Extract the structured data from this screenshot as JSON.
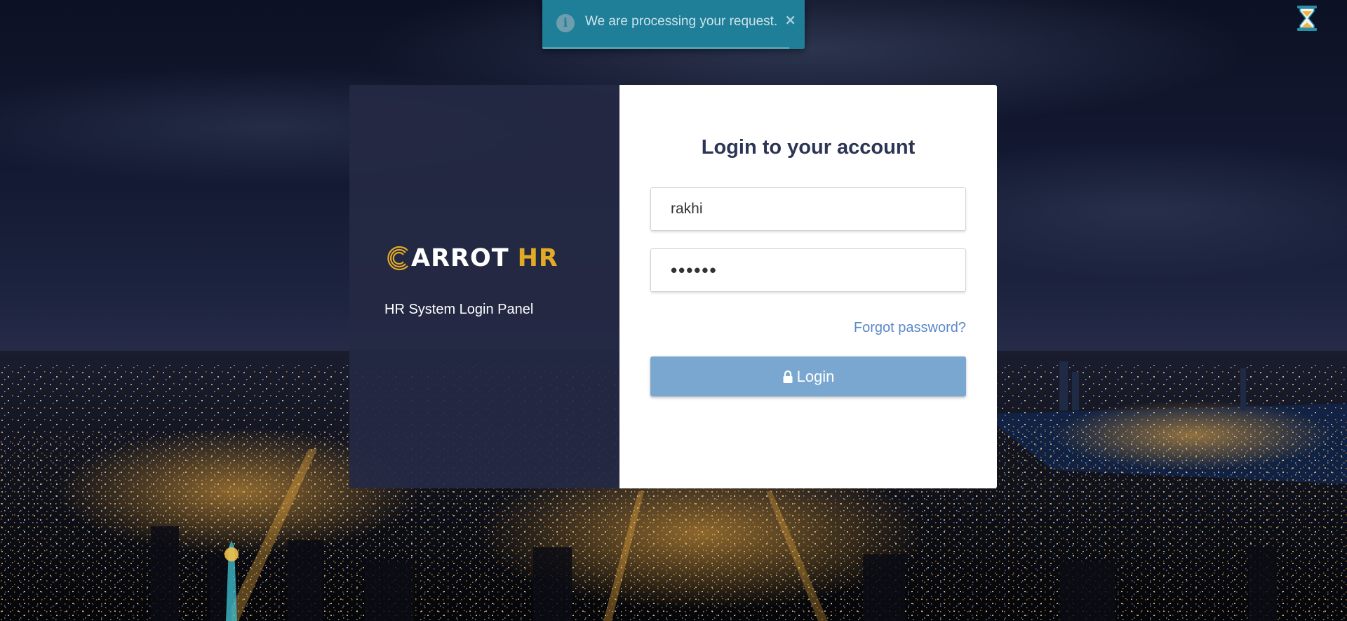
{
  "notification": {
    "message": "We are processing your request.",
    "close_symbol": "×",
    "icon": "info-icon",
    "background_color": "#1f7e98",
    "progress_fraction": 0.94
  },
  "status_indicator": {
    "icon": "hourglass-icon"
  },
  "brand": {
    "logo_text": "ARROT",
    "logo_accent_text": "HR",
    "accent_color": "#e2aa25",
    "subtitle": "HR System Login Panel"
  },
  "login_form": {
    "heading": "Login to your account",
    "username_value": "rakhi",
    "password_value": "••••••",
    "forgot_password_label": "Forgot password?",
    "login_button_label": "Login",
    "login_button_icon": "lock-icon",
    "login_button_color": "#7aa7cf",
    "link_color": "#5b87c9"
  }
}
